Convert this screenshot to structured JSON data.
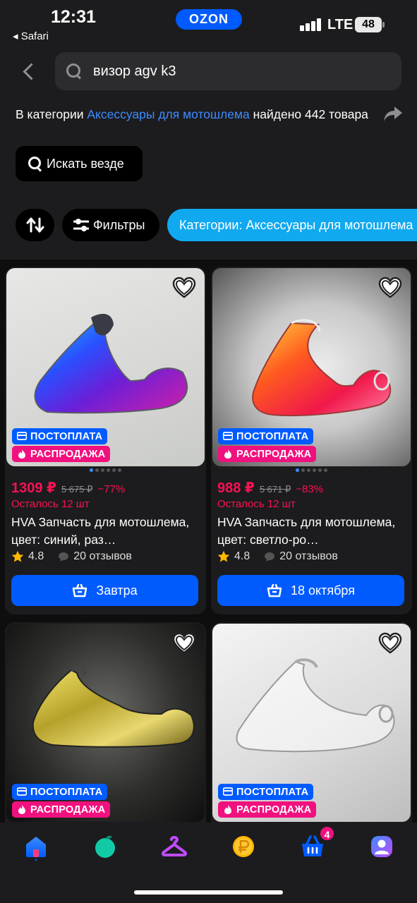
{
  "status_bar": {
    "time": "12:31",
    "back_app": "◂ Safari",
    "brand": "OZON",
    "network": "LTE",
    "battery": "48"
  },
  "search": {
    "query": "визор agv k3",
    "result_prefix": "В категории ",
    "result_category": "Аксессуары для мотошлема",
    "result_suffix": " найдено 442 товара",
    "search_everywhere": "Искать везде"
  },
  "chips": {
    "filters": "Фильтры",
    "category": "Категории: Аксессуары для мотошлема"
  },
  "products": [
    {
      "price": "1309 ₽",
      "old_price": "5 675 ₽",
      "discount": "−77%",
      "stock": "Осталось 12 шт",
      "title": "HVA Запчасть для мотошлема, цвет: синий, раз…",
      "rating": "4.8",
      "reviews": "20 отзывов",
      "delivery": "Завтра",
      "badge_post": "ПОСТОПЛАТА",
      "badge_sale": "РАСПРОДАЖА"
    },
    {
      "price": "988 ₽",
      "old_price": "5 671 ₽",
      "discount": "−83%",
      "stock": "Осталось 12 шт",
      "title": "HVA Запчасть для мотошлема, цвет: светло-ро…",
      "rating": "4.8",
      "reviews": "20 отзывов",
      "delivery": "18 октября",
      "badge_post": "ПОСТОПЛАТА",
      "badge_sale": "РАСПРОДАЖА"
    },
    {
      "badge_post": "ПОСТОПЛАТА",
      "badge_sale": "РАСПРОДАЖА"
    },
    {
      "badge_post": "ПОСТОПЛАТА",
      "badge_sale": "РАСПРОДАЖА"
    }
  ],
  "tabbar": {
    "cart_count": "4"
  },
  "colors": {
    "accent_blue": "#005bff",
    "sale_pink": "#f1117e",
    "price_red": "#f91155",
    "category_chip": "#10a9f0"
  }
}
